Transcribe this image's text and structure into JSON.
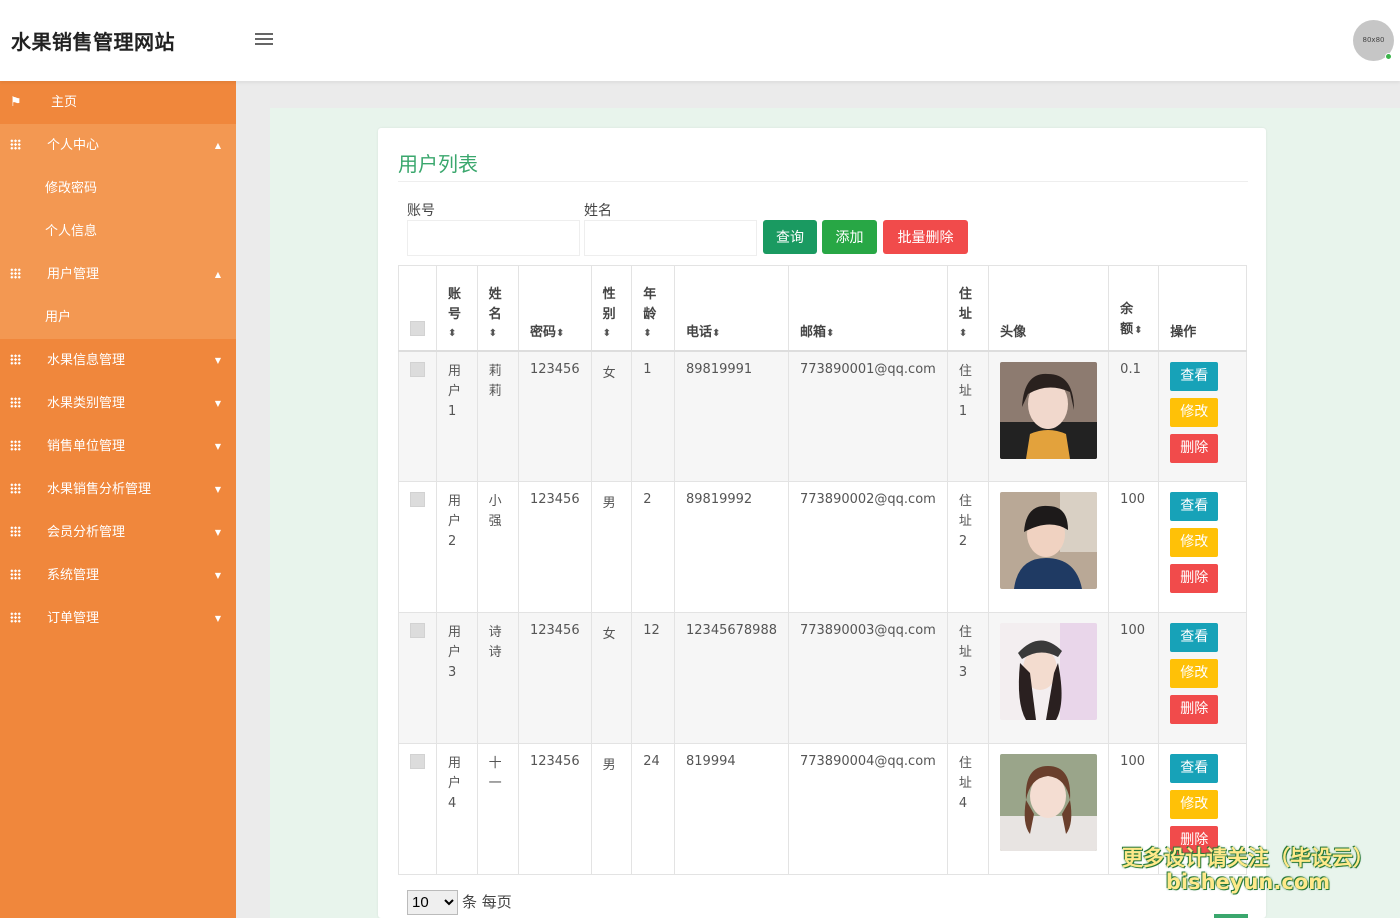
{
  "header": {
    "brand": "水果销售管理网站",
    "avatar_text": "80x80"
  },
  "sidebar": {
    "items": [
      {
        "label": "主页",
        "icon": "flag-icon"
      },
      {
        "label": "个人中心",
        "icon": "grid-icon",
        "expanded": true
      },
      {
        "label": "修改密码",
        "sub": true
      },
      {
        "label": "个人信息",
        "sub": true
      },
      {
        "label": "用户管理",
        "icon": "grid-icon",
        "expanded": true
      },
      {
        "label": "用户",
        "sub": true
      },
      {
        "label": "水果信息管理",
        "icon": "grid-icon"
      },
      {
        "label": "水果类别管理",
        "icon": "grid-icon"
      },
      {
        "label": "销售单位管理",
        "icon": "grid-icon"
      },
      {
        "label": "水果销售分析管理",
        "icon": "grid-icon"
      },
      {
        "label": "会员分析管理",
        "icon": "grid-icon"
      },
      {
        "label": "系统管理",
        "icon": "grid-icon"
      },
      {
        "label": "订单管理",
        "icon": "grid-icon"
      }
    ]
  },
  "main": {
    "title": "用户列表",
    "filters": {
      "account_label": "账号",
      "account_value": "",
      "name_label": "姓名",
      "name_value": ""
    },
    "buttons": {
      "query": "查询",
      "add": "添加",
      "batch_delete": "批量删除"
    },
    "colors": {
      "query": "#1a9a61",
      "add": "#28a745",
      "batch_delete": "#f14b4b",
      "sidebar": "#f0873c",
      "title": "#3aa76d"
    },
    "table": {
      "columns": [
        "账号",
        "姓名",
        "密码",
        "性别",
        "年龄",
        "电话",
        "邮箱",
        "住址",
        "头像",
        "余额",
        "操作"
      ],
      "sort_icon": "⬍",
      "rows": [
        {
          "account": "用户1",
          "name": "莉莉",
          "password": "123456",
          "gender": "女",
          "age": "1",
          "phone": "89819991",
          "email": "773890001@qq.com",
          "address": "住址1",
          "balance": "0.1"
        },
        {
          "account": "用户2",
          "name": "小强",
          "password": "123456",
          "gender": "男",
          "age": "2",
          "phone": "89819992",
          "email": "773890002@qq.com",
          "address": "住址2",
          "balance": "100"
        },
        {
          "account": "用户3",
          "name": "诗诗",
          "password": "123456",
          "gender": "女",
          "age": "12",
          "phone": "12345678988",
          "email": "773890003@qq.com",
          "address": "住址3",
          "balance": "100"
        },
        {
          "account": "用户4",
          "name": "十一",
          "password": "123456",
          "gender": "男",
          "age": "24",
          "phone": "819994",
          "email": "773890004@qq.com",
          "address": "住址4",
          "balance": "100"
        }
      ],
      "actions": {
        "view": "查看",
        "edit": "修改",
        "delete": "删除"
      }
    },
    "pagination": {
      "page_size": "10",
      "per_page_label": "条 每页"
    }
  },
  "watermark": {
    "line1": "更多设计请关注（毕设云）",
    "line2": "bisheyun.com"
  }
}
